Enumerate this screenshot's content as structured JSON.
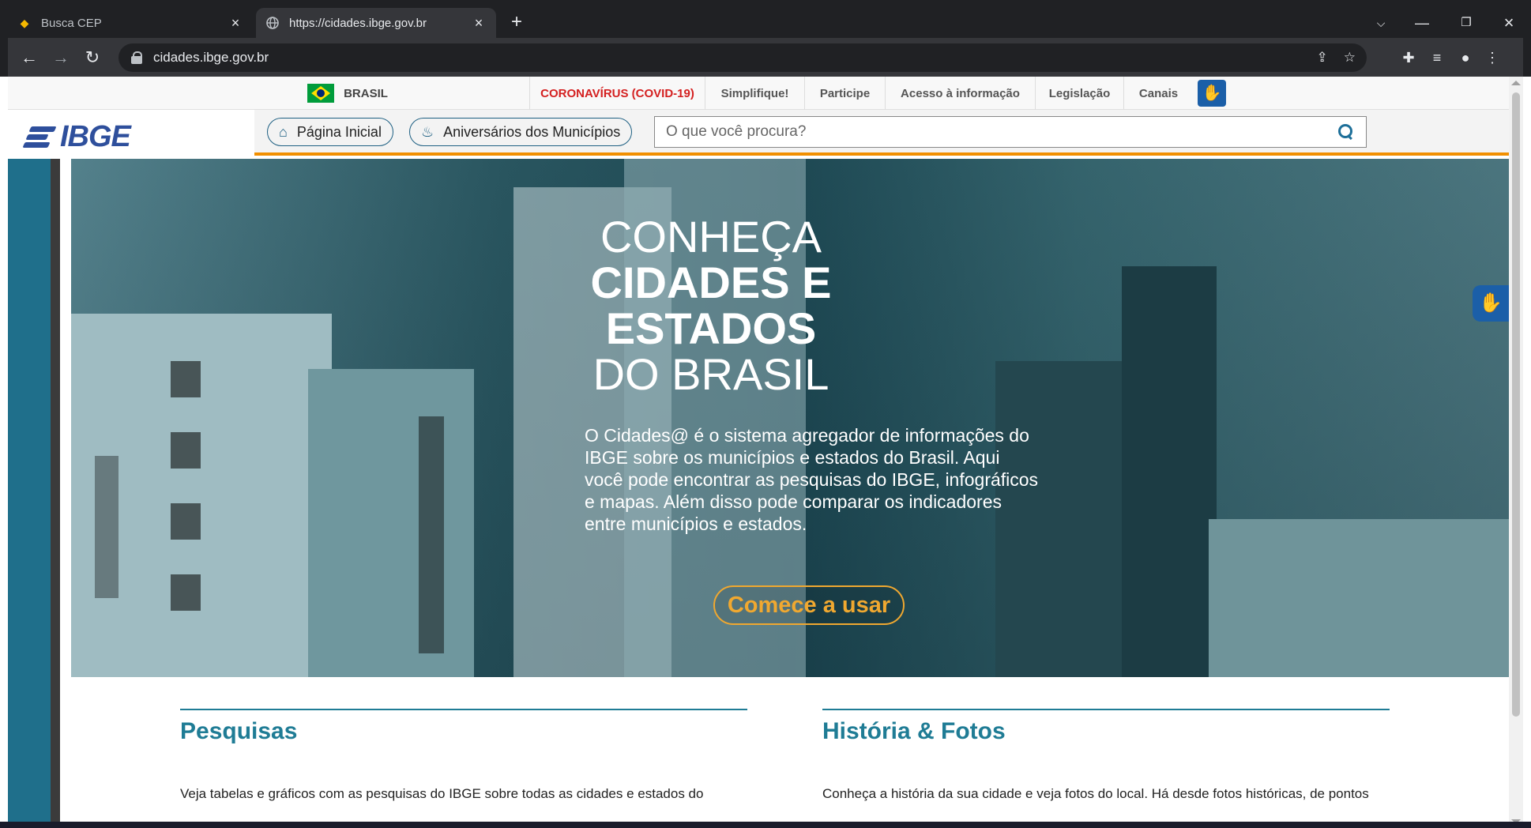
{
  "browser": {
    "tabs": [
      {
        "title": "Busca CEP",
        "active": false,
        "favicon": "correios-icon"
      },
      {
        "title": "https://cidades.ibge.gov.br",
        "active": true,
        "favicon": "globe-icon"
      }
    ],
    "url": "cidades.ibge.gov.br"
  },
  "govbar": {
    "brasil": "BRASIL",
    "links": [
      "CORONAVÍRUS (COVID-19)",
      "Simplifique!",
      "Participe",
      "Acesso à informação",
      "Legislação",
      "Canais"
    ]
  },
  "header": {
    "logo_text": "IBGE",
    "home_label": "Página Inicial",
    "anniversaries_label": "Aniversários dos Municípios",
    "search_placeholder": "O que você procura?"
  },
  "hero": {
    "title_line1": "CONHEÇA",
    "title_line2": "CIDADES E",
    "title_line3": "ESTADOS",
    "title_line4": "DO BRASIL",
    "description": "O Cidades@ é o sistema agregador de informações do IBGE sobre os municípios e estados do Brasil. Aqui você pode encontrar as pesquisas do IBGE, infográficos e mapas. Além disso pode comparar os indicadores entre municípios e estados.",
    "cta_label": "Comece a usar"
  },
  "sections": [
    {
      "title": "Pesquisas",
      "text": "Veja tabelas e gráficos com as pesquisas do IBGE sobre todas as cidades e estados do"
    },
    {
      "title": "História & Fotos",
      "text": "Conheça a história da sua cidade e veja fotos do local. Há desde fotos históricas, de pontos"
    }
  ],
  "colors": {
    "accent_teal": "#1f7c95",
    "ibge_blue": "#2e4f9c",
    "orange_rule": "#f18f00",
    "cta_orange": "#f0a830",
    "covid_red": "#d42020"
  }
}
